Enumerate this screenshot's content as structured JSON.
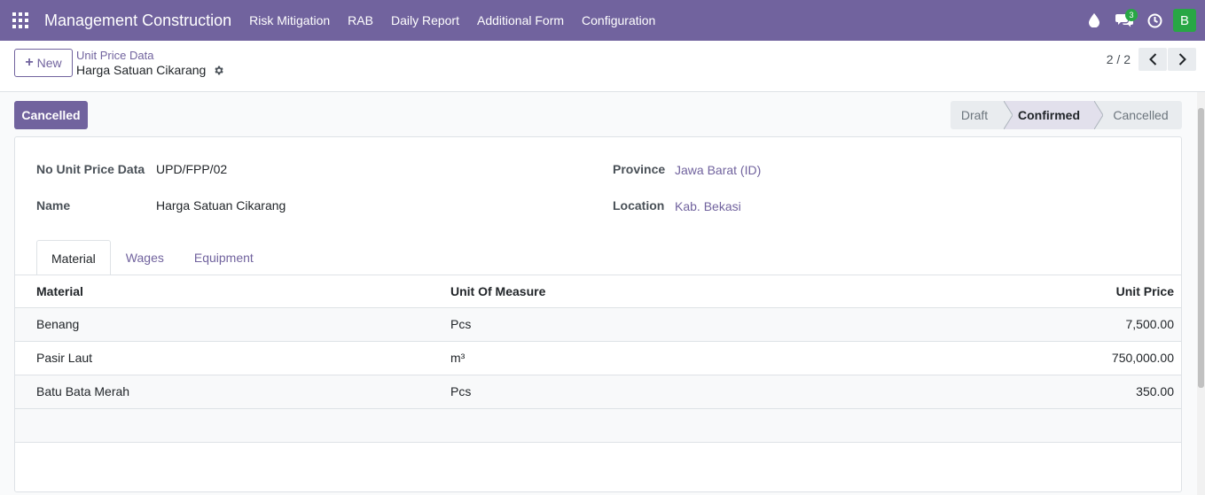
{
  "navbar": {
    "brand": "Management Construction",
    "menu": [
      "Risk Mitigation",
      "RAB",
      "Daily Report",
      "Additional Form",
      "Configuration"
    ],
    "chat_count": "3",
    "avatar_initial": "B"
  },
  "control_panel": {
    "new_label": "New",
    "breadcrumb_parent": "Unit Price Data",
    "breadcrumb_current": "Harga Satuan Cikarang",
    "pager_value": "2 / 2"
  },
  "status": {
    "action_button": "Cancelled",
    "stages": [
      "Draft",
      "Confirmed",
      "Cancelled"
    ],
    "current_stage": "Confirmed"
  },
  "form": {
    "no_label": "No Unit Price Data",
    "no_value": "UPD/FPP/02",
    "name_label": "Name",
    "name_value": "Harga Satuan Cikarang",
    "province_label": "Province",
    "province_value": "Jawa Barat (ID)",
    "location_label": "Location",
    "location_value": "Kab. Bekasi"
  },
  "tabs": [
    "Material",
    "Wages",
    "Equipment"
  ],
  "table": {
    "headers": [
      "Material",
      "Unit Of Measure",
      "Unit Price"
    ],
    "rows": [
      [
        "Benang",
        "Pcs",
        "7,500.00"
      ],
      [
        "Pasir Laut",
        "m³",
        "750,000.00"
      ],
      [
        "Batu Bata Merah",
        "Pcs",
        "350.00"
      ]
    ]
  },
  "colors": {
    "brand": "#71639e",
    "badge": "#28a745",
    "current_stage_bg": "#e2e0ec"
  }
}
